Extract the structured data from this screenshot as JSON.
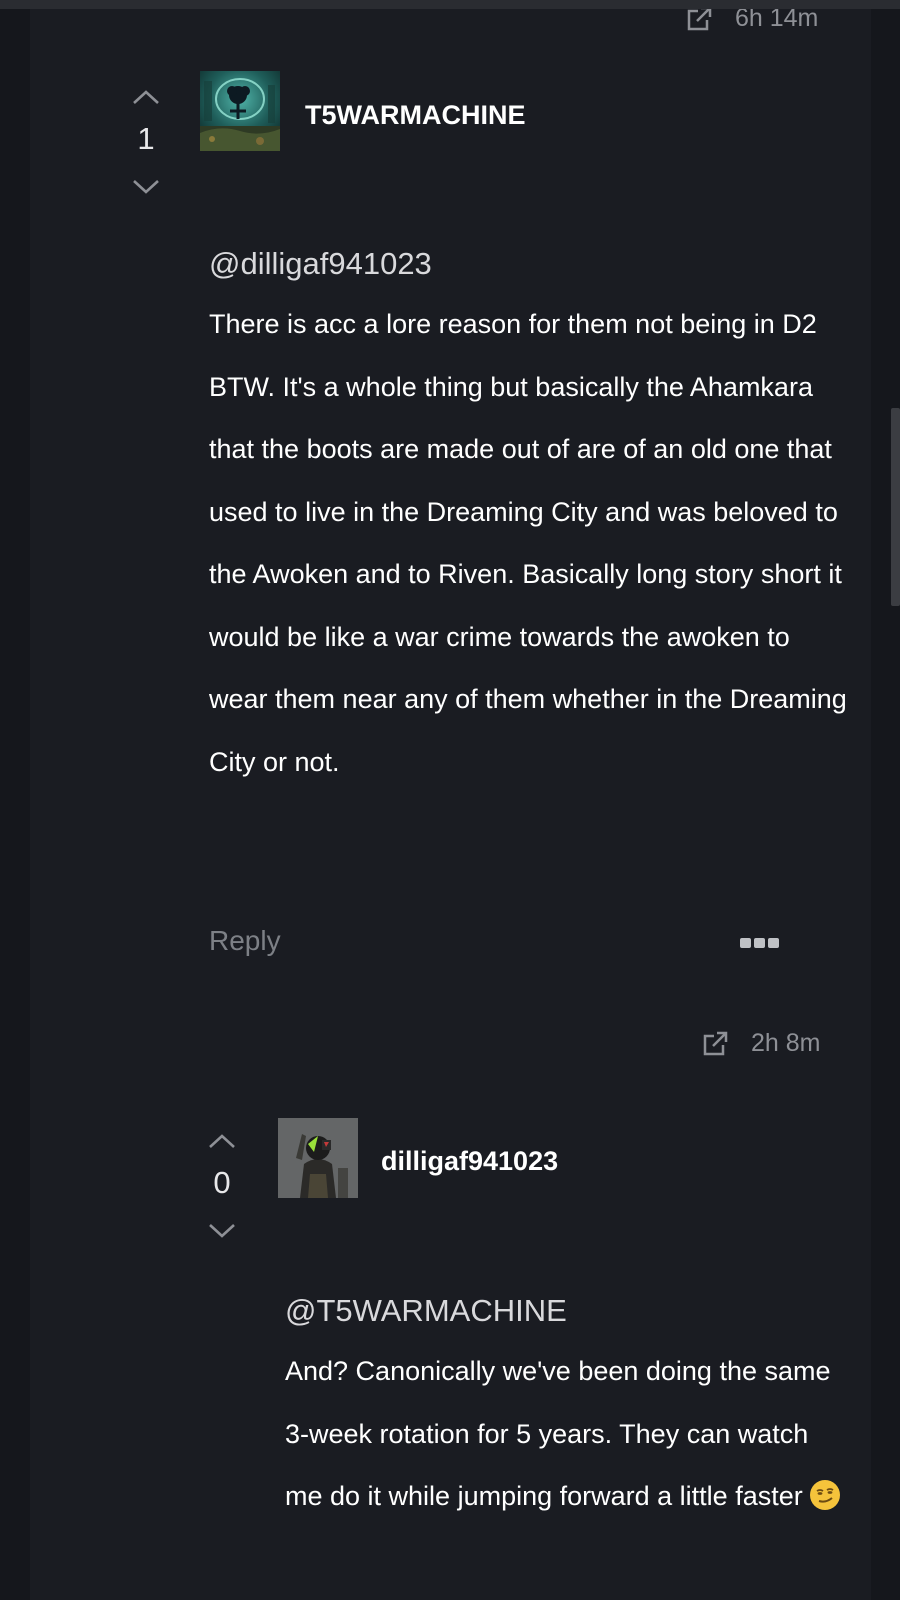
{
  "comments": [
    {
      "timestamp": "6h 14m",
      "score": "1",
      "username": "T5WARMACHINE",
      "mention": "@dilligaf941023",
      "body": "There is acc a lore reason for them not being in D2 BTW. It's a whole thing but basically the Ahamkara that the boots are made out of are of an old one that used to live in the Dreaming City and was beloved to the Awoken and to Riven. Basically long story short it would be like a war crime towards the awoken to wear them near any of them whether in the Dreaming City or not.",
      "reply_label": "Reply"
    },
    {
      "timestamp": "2h 8m",
      "score": "0",
      "username": "dilligaf941023",
      "mention": "@T5WARMACHINE",
      "body": "And? Canonically we've been doing the same 3-week rotation for 5 years. They can watch me do it while jumping forward a little faster"
    }
  ],
  "icons": {
    "share": "external-link-icon",
    "upvote": "chevron-up-icon",
    "downvote": "chevron-down-icon",
    "more": "more-dots-icon",
    "emoji": "smirking-face-emoji"
  },
  "colors": {
    "background": "#1a1c22",
    "text": "#ffffff",
    "muted": "#8e9096"
  }
}
